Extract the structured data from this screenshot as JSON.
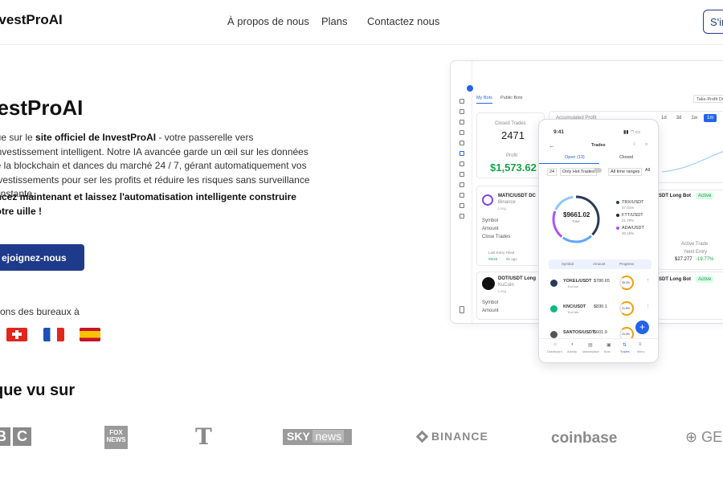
{
  "header": {
    "brand": "nvestProAI",
    "nav": [
      "À propos de nous",
      "Plans",
      "Contactez nous"
    ],
    "signin": "S'in"
  },
  "hero": {
    "title": "vestProAI",
    "para_pre": "nue sur le ",
    "para_bold": "site officiel de InvestProAI",
    "para_post": " - votre passerelle vers l'investissement intelligent. Notre IA avancée garde un œil sur les données de la blockchain et dances du marché 24 / 7, gérant automatiquement vos investissements pour ser les profits et réduire les risques sans surveillance constante.",
    "cta_text": "encez maintenant et laissez l'automatisation intelligente construire votre uille !",
    "button": "ejoignez-nous",
    "offices": "vons des bureaux à"
  },
  "seen_on": {
    "title": "que vu sur",
    "logos": [
      "BC",
      "FOX NEWS",
      "T",
      "SKY news",
      "BINANCE",
      "coinbase",
      "GE"
    ]
  },
  "dashboard": {
    "tabs": [
      "My Bots",
      "Public Bots"
    ],
    "closed_trades_label": "Closed Trades",
    "closed_trades": "2471",
    "profit_label": "Profit",
    "profit": "$1,573.62",
    "accumulated": "Accumulated Profit",
    "ranges": [
      "1d",
      "3d",
      "1w",
      "1m",
      "3m",
      "1y"
    ],
    "take_profit": "Take-Profit Dist",
    "bot1": {
      "name": "MATIC/USDT DC",
      "exchange": "Binance",
      "side": "Long"
    },
    "bot2": {
      "name": "DOT/USDT Long",
      "exchange": "KuCoin",
      "side": "Long"
    },
    "labels": [
      "Symbol",
      "Amount",
      "Close Trades",
      "Last Entry Filled",
      "9h ago"
    ],
    "right_bot1": "SDT Long Bot",
    "right_bot2": "SDT Long Bot",
    "active": "Active",
    "active_trade": "Active Trade",
    "next_entry": "Next Entry",
    "price1": "$27.277",
    "pct1": "-19.77%",
    "progress_small": "#5/20"
  },
  "phone": {
    "time": "9:41",
    "title": "Trades",
    "tabs": [
      "Open (13)",
      "Closed"
    ],
    "filters": [
      "24",
      "Only Hot Trades",
      "All time ranges",
      "All"
    ],
    "total": "$9661.02",
    "total_label": "Total",
    "legend": [
      {
        "name": "TRX/USDT",
        "pct": "37.01%",
        "color": "#2b3a55"
      },
      {
        "name": "FTT/USDT",
        "pct": "21.79%",
        "color": "#1f2937"
      },
      {
        "name": "ADA/USDT",
        "pct": "20.16%",
        "color": "#a855f7"
      }
    ],
    "header_cols": [
      "Symbol",
      "Amount",
      "Progress"
    ],
    "rows": [
      {
        "sym": "YOKEL/USDT",
        "ex": "KuCoin",
        "amt": "$780.65",
        "pct": "35.2%"
      },
      {
        "sym": "KNC/USDT",
        "ex": "KuCoin",
        "amt": "$830.1",
        "pct": "21.5%"
      },
      {
        "sym": "SANTOS/USDT",
        "ex": "",
        "amt": "$601.9",
        "pct": "20.0%"
      }
    ],
    "bottom_nav": [
      "Dashboard",
      "Activity",
      "Marketplace",
      "Bots",
      "Trades",
      "Menu"
    ]
  },
  "colors": {
    "primary": "#1e3a8a",
    "profit": "#16a34a",
    "accent": "#2563eb"
  }
}
